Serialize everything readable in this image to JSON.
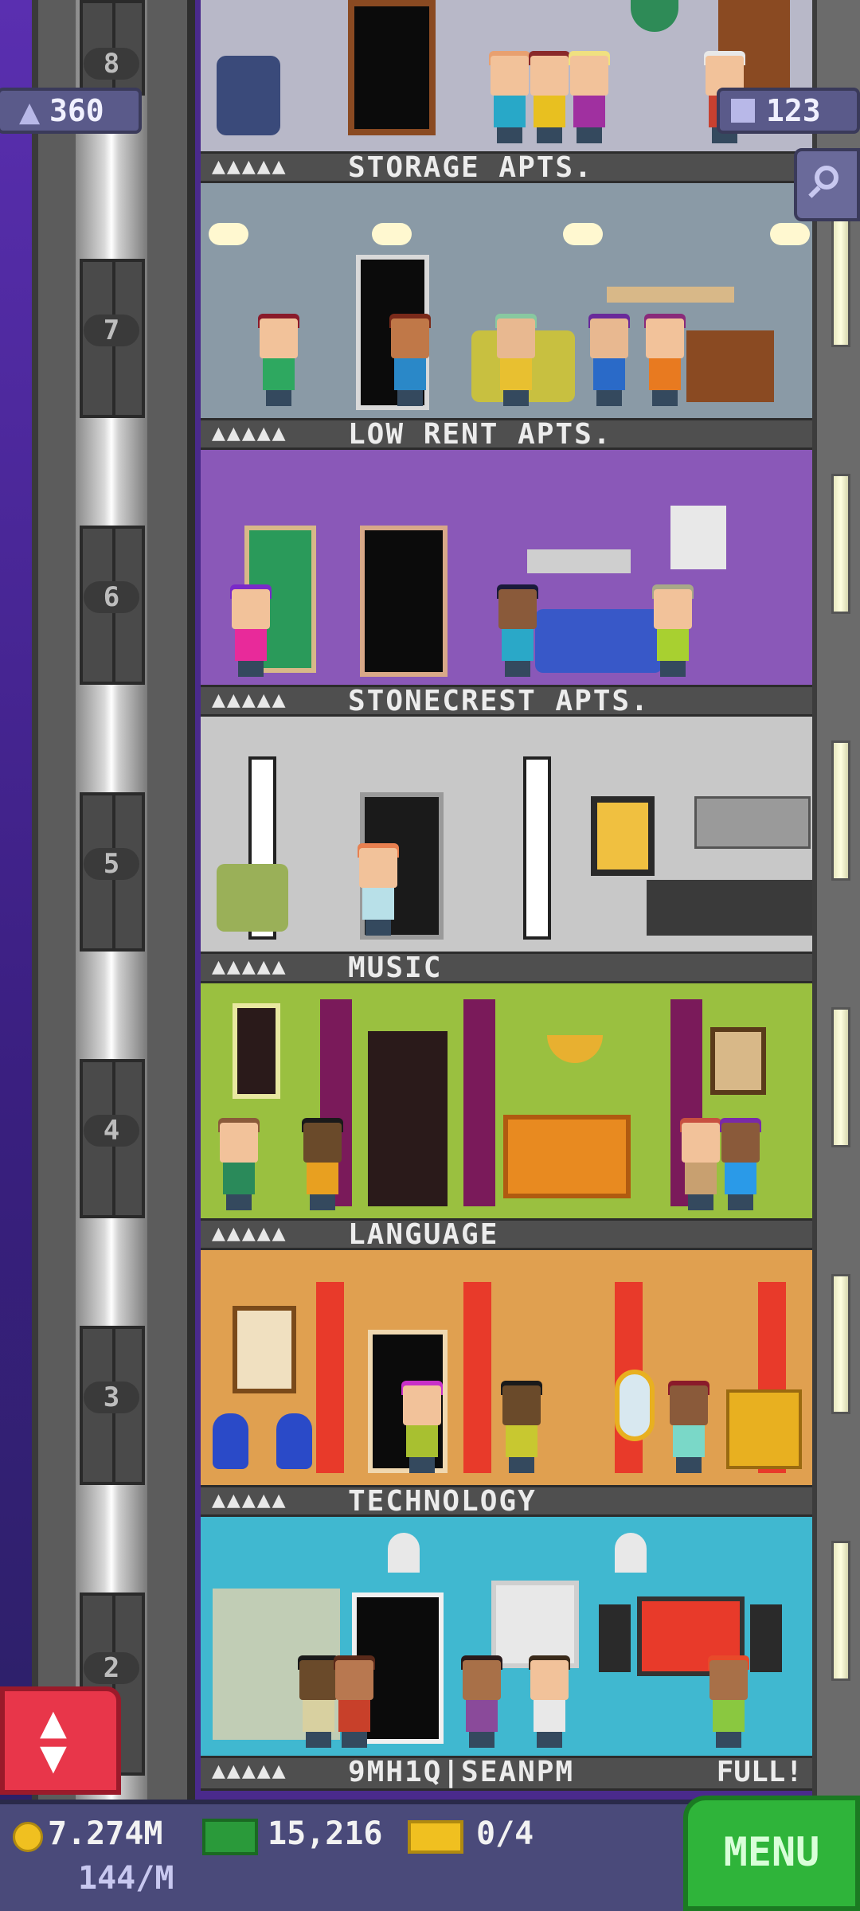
{
  "hud": {
    "population": "360",
    "floors_count": "123"
  },
  "floors": [
    {
      "number": "8",
      "name": "STORAGE APTS.",
      "stars": "▲▲▲▲▲",
      "right": ""
    },
    {
      "number": "7",
      "name": "LOW RENT APTS.",
      "stars": "▲▲▲▲▲",
      "right": ""
    },
    {
      "number": "6",
      "name": "STONECREST APTS.",
      "stars": "▲▲▲▲▲",
      "right": ""
    },
    {
      "number": "5",
      "name": "MUSIC",
      "stars": "▲▲▲▲▲",
      "right": ""
    },
    {
      "number": "4",
      "name": "LANGUAGE",
      "stars": "▲▲▲▲▲",
      "right": ""
    },
    {
      "number": "3",
      "name": "TECHNOLOGY",
      "stars": "▲▲▲▲▲",
      "right": ""
    },
    {
      "number": "2",
      "name": "9MH1Q|SEANPM",
      "stars": "▲▲▲▲▲",
      "right": "FULL!"
    }
  ],
  "bottom_bar": {
    "coins": "7.274M",
    "coins_rate": "144/M",
    "bux": "15,216",
    "vip": "0/4",
    "menu_label": "MENU"
  },
  "icons": {
    "population": "person-icon",
    "floors": "building-icon",
    "search": "magnifier-icon",
    "elevator": "elevator-arrows-icon",
    "coin": "coin-icon",
    "bux": "bux-bill-icon",
    "vip": "ticket-icon"
  },
  "colors": {
    "menu_green": "#2fb43a",
    "elevator_red": "#e8364a",
    "hud_purple": "#5a5a8a"
  }
}
